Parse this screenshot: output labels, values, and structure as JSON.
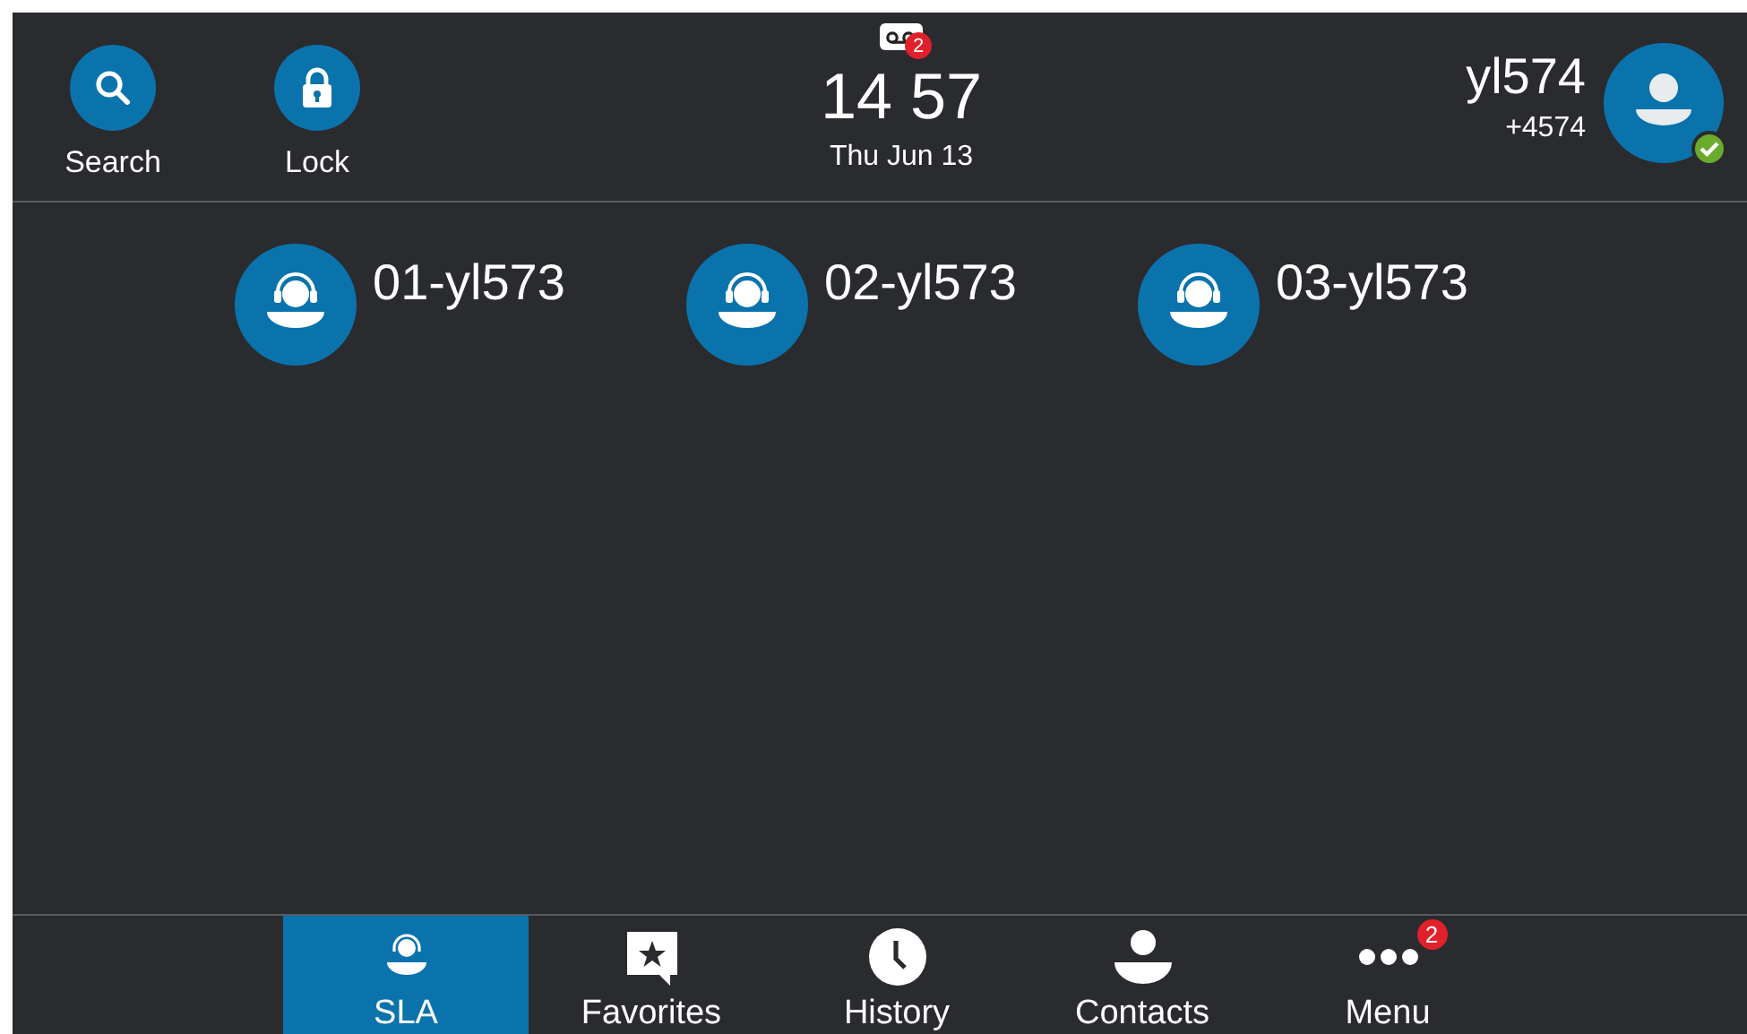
{
  "header": {
    "actions": [
      {
        "label": "Search"
      },
      {
        "label": "Lock"
      }
    ],
    "voicemail": {
      "badge": "2"
    },
    "time": "14 57",
    "date": "Thu Jun 13",
    "account": {
      "name": "yl574",
      "number": "+4574",
      "online": true
    }
  },
  "lines": [
    {
      "label": "01-yl573"
    },
    {
      "label": "02-yl573"
    },
    {
      "label": "03-yl573"
    }
  ],
  "tabs": [
    {
      "label": "SLA",
      "selected": true
    },
    {
      "label": "Favorites",
      "selected": false
    },
    {
      "label": "History",
      "selected": false
    },
    {
      "label": "Contacts",
      "selected": false
    },
    {
      "label": "Menu",
      "selected": false,
      "badge": "2"
    }
  ]
}
